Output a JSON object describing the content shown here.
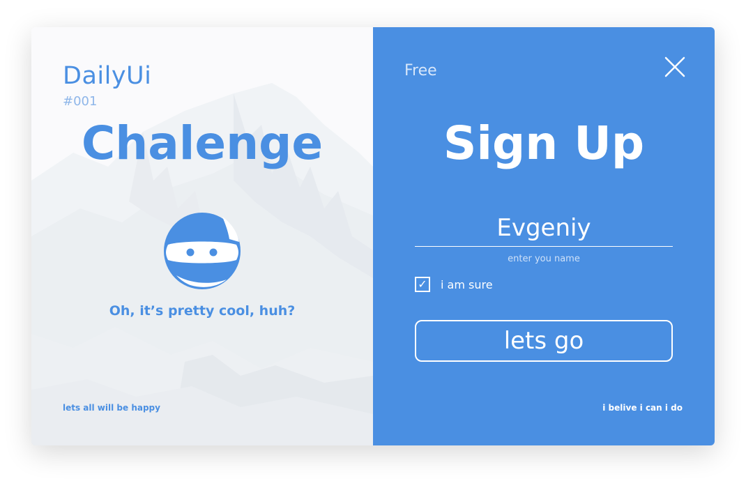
{
  "left": {
    "brand": "DailyUi",
    "number": "#001",
    "headline": "Chalenge",
    "tagline": "Oh, it’s pretty cool, huh?",
    "footer": "lets all will be happy",
    "background": "snowy-mountain-image",
    "mascot": "ninja-icon"
  },
  "right": {
    "badge": "Free",
    "headline": "Sign Up",
    "name_value": "Evgeniy",
    "name_placeholder": "enter you name",
    "checkbox_label": "i am sure",
    "checkbox_checked": true,
    "button_label": "lets go",
    "footer": "i belive i can i do",
    "close_icon": "close-icon"
  },
  "colors": {
    "accent": "#4a8fe2",
    "panel_light": "#f7f8fa",
    "text_on_accent": "#ffffff"
  }
}
